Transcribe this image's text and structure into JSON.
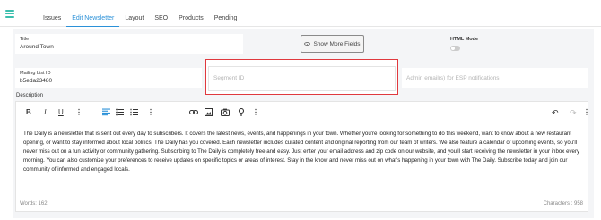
{
  "tabs": [
    {
      "label": "Issues"
    },
    {
      "label": "Edit Newsletter"
    },
    {
      "label": "Layout"
    },
    {
      "label": "SEO"
    },
    {
      "label": "Products"
    },
    {
      "label": "Pending"
    }
  ],
  "active_tab": "Edit Newsletter",
  "fields": {
    "title_label": "Title",
    "title_value": "Around Town",
    "show_more_label": "Show More Fields",
    "html_mode_label": "HTML Mode",
    "mailing_list_label": "Mailing List ID",
    "mailing_list_value": "b5eda23480",
    "segment_placeholder": "Segment ID",
    "admin_emails_placeholder": "Admin email(s) for ESP notifications",
    "description_label": "Description"
  },
  "editor": {
    "content": "The Daily is a newsletter that is sent out every day to subscribers. It covers the latest news, events, and happenings in your town. Whether you're looking for something to do this weekend, want to know about a new restaurant opening, or want to stay informed about local politics, The Daily has you covered. Each newsletter includes curated content and original reporting from our team of writers. We also feature a calendar of upcoming events, so you'll never miss out on a fun activity or community gathering. Subscribing to The Daily is completely free and easy. Just enter your email address and zip code on our website, and you'll start receiving the newsletter in your inbox every morning. You can also customize your preferences to receive updates on specific topics or areas of interest. Stay in the know and never miss out on what's happening in your town with The Daily. Subscribe today and join our community of informed and engaged locals.",
    "word_count": "Words: 162",
    "char_count": "Characters : 958"
  },
  "colors": {
    "accent": "#2b91d8",
    "teal": "#3cbfae",
    "highlight_border": "#e0393e",
    "panel_bg": "#f4f5f7"
  }
}
